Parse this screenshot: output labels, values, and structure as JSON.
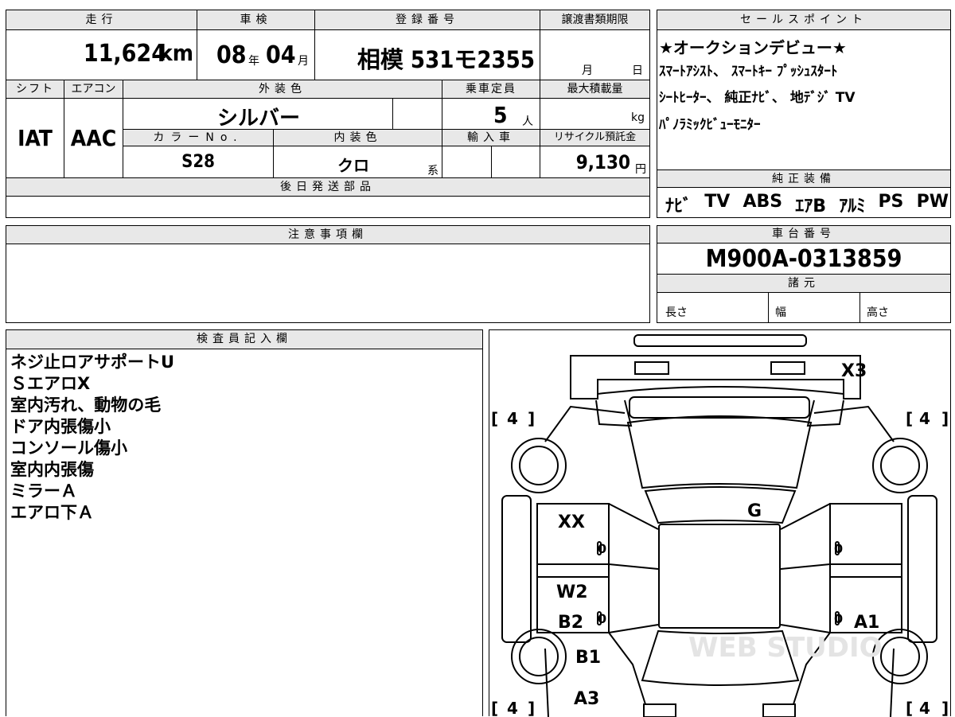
{
  "top": {
    "mileage_label": "走行",
    "mileage_value": "11,624",
    "mileage_unit": "km",
    "inspection_label": "車検",
    "inspection_year": "08",
    "year_unit": "年",
    "inspection_month": "04",
    "month_unit": "月",
    "registration_label": "登録番号",
    "registration_value": "相模 531モ2355",
    "transfer_label": "譲渡書類期限",
    "transfer_month_unit": "月",
    "transfer_day_unit": "日"
  },
  "row2": {
    "shift_label": "シフト",
    "shift_value": "IAT",
    "ac_label": "エアコン",
    "ac_value": "AAC",
    "exterior_color_label": "外装色",
    "exterior_color_value": "シルバー",
    "capacity_label": "乗車定員",
    "capacity_value": "5",
    "capacity_unit": "人",
    "max_load_label": "最大積載量",
    "max_load_unit": "kg"
  },
  "row3": {
    "color_no_label": "カラーNo.",
    "color_no_value": "S28",
    "interior_color_label": "内装色",
    "interior_color_value": "クロ",
    "interior_suffix": "系",
    "import_label": "輸入車",
    "recycle_label": "リサイクル預託金",
    "recycle_value": "9,130",
    "recycle_unit": "円"
  },
  "later_parts_label": "後日発送部品",
  "sales_points": {
    "label": "セールスポイント",
    "lines": [
      "★オークションデビュー★",
      "ｽﾏｰﾄｱｼｽﾄ、 ｽﾏｰﾄｷｰ  ﾌﾟｯｼｭｽﾀｰﾄ",
      "ｼｰﾄﾋｰﾀｰ、 純正ﾅﾋﾞ、 地ﾃﾞｼﾞ TV",
      "ﾊﾟﾉﾗﾐｯｸﾋﾞｭｰﾓﾆﾀｰ"
    ]
  },
  "equipment": {
    "label": "純正装備",
    "items": [
      "ﾅﾋﾞ",
      "TV",
      "ABS",
      "ｴｱB",
      "ｱﾙﾐ",
      "PS",
      "PW"
    ]
  },
  "notes_label": "注意事項欄",
  "chassis": {
    "label": "車台番号",
    "value": "M900A-0313859",
    "specs_label": "諸元",
    "length_label": "長さ",
    "width_label": "幅",
    "height_label": "高さ"
  },
  "inspector": {
    "label": "検査員記入欄",
    "lines": [
      "ネジ止ロアサポートU",
      "ＳエアロX",
      "室内汚れ、動物の毛",
      "ドア内張傷小",
      "コンソール傷小",
      "室内内張傷",
      "ミラーＡ",
      "エアロ下Ａ"
    ]
  },
  "diagram": {
    "tire_fl": "4",
    "tire_fr": "4",
    "tire_rl": "4",
    "tire_rr": "4",
    "mark_x3": "X3",
    "mark_g": "G",
    "mark_xx": "XX",
    "mark_w2": "W2",
    "mark_b2": "B2",
    "mark_b1": "B1",
    "mark_a3": "A3",
    "mark_a1": "A1",
    "zero": "0",
    "watermark": "WEB STUDIO"
  }
}
